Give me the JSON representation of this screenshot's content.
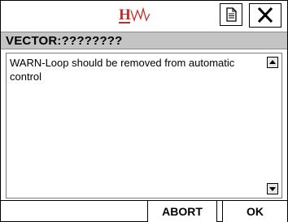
{
  "titlebar": {
    "logo_text": "HW",
    "document_icon": "document-icon",
    "close_icon": "close-icon"
  },
  "header": {
    "title": "VECTOR:????????"
  },
  "message": {
    "text": "WARN-Loop should be removed from automatic control",
    "scroll_up_icon": "scroll-up-arrow-icon",
    "scroll_down_icon": "scroll-down-arrow-icon"
  },
  "buttons": {
    "abort_label": "ABORT",
    "ok_label": "OK"
  },
  "colors": {
    "logo_red": "#c0302a",
    "header_bg": "#c4c4c4"
  }
}
